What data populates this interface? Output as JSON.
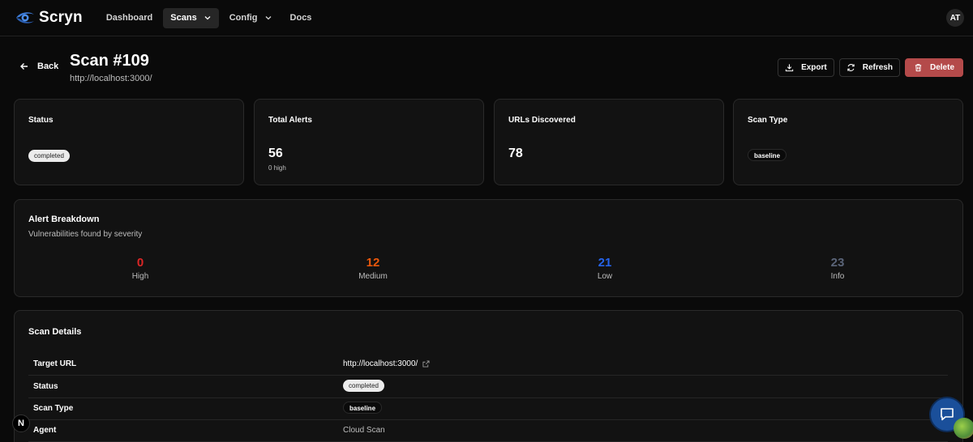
{
  "app": {
    "name": "Scryn",
    "avatar_initials": "AT",
    "accent": "#3d7bd6"
  },
  "nav": {
    "dashboard": "Dashboard",
    "scans": "Scans",
    "config": "Config",
    "docs": "Docs"
  },
  "header": {
    "back_label": "Back",
    "title": "Scan #109",
    "subtitle": "http://localhost:3000/",
    "export_label": "Export",
    "refresh_label": "Refresh",
    "delete_label": "Delete"
  },
  "stats": {
    "status": {
      "label": "Status",
      "badge": "completed"
    },
    "alerts": {
      "label": "Total Alerts",
      "value": "56",
      "sub": "0 high"
    },
    "urls": {
      "label": "URLs Discovered",
      "value": "78"
    },
    "type": {
      "label": "Scan Type",
      "badge": "baseline"
    }
  },
  "breakdown": {
    "title": "Alert Breakdown",
    "description": "Vulnerabilities found by severity",
    "high": {
      "value": "0",
      "label": "High",
      "color": "#dc2626"
    },
    "medium": {
      "value": "12",
      "label": "Medium",
      "color": "#ea580c"
    },
    "low": {
      "value": "21",
      "label": "Low",
      "color": "#2563eb"
    },
    "info": {
      "value": "23",
      "label": "Info",
      "color": "#5a6478"
    }
  },
  "details": {
    "title": "Scan Details",
    "rows": [
      {
        "key": "Target URL",
        "value": "http://localhost:3000/"
      },
      {
        "key": "Status",
        "value": "completed"
      },
      {
        "key": "Scan Type",
        "value": "baseline"
      },
      {
        "key": "Agent",
        "value": "Cloud Scan"
      }
    ]
  },
  "floating": {
    "next_badge": "N"
  }
}
